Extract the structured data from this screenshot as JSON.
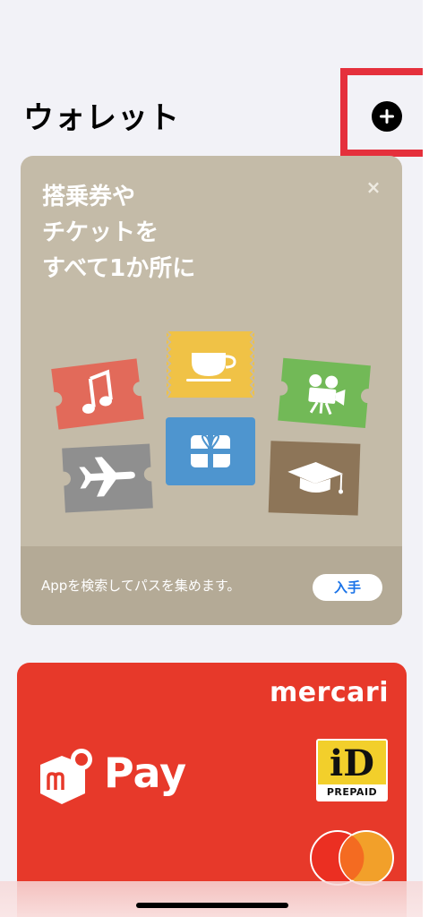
{
  "header": {
    "title": "ウォレット"
  },
  "promo_card": {
    "heading_lines": [
      "搭乗券や",
      "チケットを",
      "すべて1か所に"
    ],
    "close_symbol": "×",
    "footer_text": "Appを検索してパスを集めます。",
    "get_button_label": "入手",
    "ticket_icons": [
      "music-note-icon",
      "coffee-cup-icon",
      "movie-camera-icon",
      "airplane-icon",
      "gift-icon",
      "graduation-cap-icon"
    ]
  },
  "mercari_card": {
    "brand": "mercari",
    "pay_label": "Pay",
    "id_label": "iD",
    "prepaid_label": "PREPAID",
    "network": "Mastercard"
  },
  "colors": {
    "highlight": "#e5303c",
    "promo_bg": "#c4bba8",
    "card_red": "#e7392a",
    "link_blue": "#1a73e8"
  }
}
